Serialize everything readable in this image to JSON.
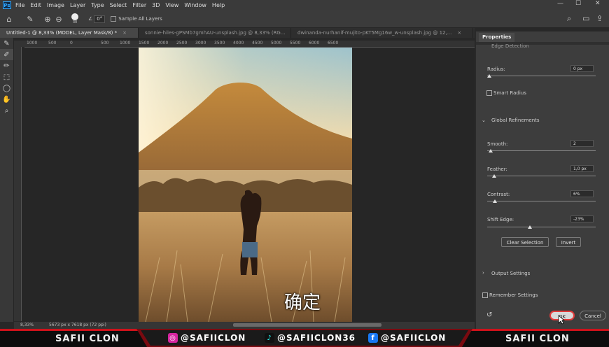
{
  "app": {
    "logo": "Ps"
  },
  "menu": [
    "File",
    "Edit",
    "Image",
    "Layer",
    "Type",
    "Select",
    "Filter",
    "3D",
    "View",
    "Window",
    "Help"
  ],
  "window_controls": {
    "minimize": "—",
    "maximize": "☐",
    "close": "✕"
  },
  "options": {
    "brush_size": "30",
    "angle_label": "∠",
    "angle_value": "0°",
    "sample_all_layers": "Sample All Layers"
  },
  "tabs": [
    {
      "label": "Untitled-1 @ 8,33% (MODEL, Layer Mask/8) *",
      "close": "×"
    },
    {
      "label": "sonnie-hiles-gPSMb7gmhAU-unsplash.jpg @ 8,33% (RG...",
      "close": "×"
    },
    {
      "label": "dwinanda-nurhanif-mujito-pKT5Mg16w_w-unsplash.jpg @ 12,...",
      "close": "×"
    }
  ],
  "ruler_ticks": [
    "1000",
    "500",
    "0",
    "500",
    "1000",
    "1500",
    "2000",
    "2500",
    "3000",
    "3500",
    "4000",
    "4500",
    "5000",
    "5500",
    "6000",
    "6500"
  ],
  "status": {
    "zoom": "8,33%",
    "doc_size": "5673 px x 7618 px (72 ppi)"
  },
  "subtitle": "确定",
  "properties": {
    "tab": "Properties",
    "edge_detection": "Edge Detection",
    "radius_label": "Radius:",
    "radius_value": "0 px",
    "smart_radius": "Smart Radius",
    "global_refinements": "Global Refinements",
    "smooth_label": "Smooth:",
    "smooth_value": "2",
    "feather_label": "Feather:",
    "feather_value": "1,0 px",
    "contrast_label": "Contrast:",
    "contrast_value": "6%",
    "shift_edge_label": "Shift Edge:",
    "shift_edge_value": "-23%",
    "clear_selection": "Clear Selection",
    "invert": "Invert",
    "output_settings": "Output Settings",
    "remember_settings": "Remember Settings",
    "ok": "OK",
    "cancel": "Cancel"
  },
  "banner": {
    "left": "SAFII CLON",
    "instagram": "@SAFIICLON",
    "tiktok": "@SAFIICLON36",
    "facebook": "@SAFIICLON",
    "right": "SAFII CLON"
  }
}
